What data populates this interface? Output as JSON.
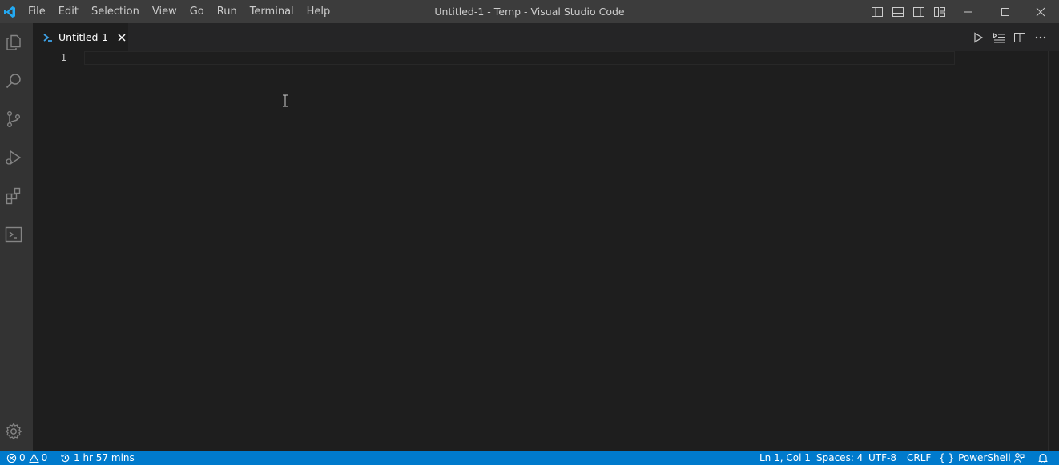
{
  "window": {
    "title": "Untitled-1 - Temp - Visual Studio Code",
    "logo_icon": "vscode-logo-icon",
    "accent_color": "#007acc"
  },
  "menu": {
    "items": [
      "File",
      "Edit",
      "Selection",
      "View",
      "Go",
      "Run",
      "Terminal",
      "Help"
    ]
  },
  "layout_controls": [
    "toggle-primary-sidebar-icon",
    "toggle-panel-icon",
    "toggle-secondary-sidebar-icon",
    "customize-layout-icon"
  ],
  "window_controls": [
    "minimize-icon",
    "maximize-icon",
    "close-icon"
  ],
  "activity_bar": {
    "items": [
      "explorer-icon",
      "search-icon",
      "source-control-icon",
      "run-debug-icon",
      "extensions-icon",
      "remote-explorer-icon"
    ],
    "bottom": "manage-gear-icon"
  },
  "tabs": [
    {
      "label": "Untitled-1",
      "icon": "powershell-icon",
      "active": true
    }
  ],
  "editor_actions": [
    "run-icon",
    "run-selection-icon",
    "split-editor-icon",
    "more-actions-icon"
  ],
  "editor": {
    "line_numbers": [
      "1"
    ]
  },
  "statusbar": {
    "errors": "0",
    "warnings": "0",
    "time_tracker": "1 hr 57 mins",
    "cursor_position": "Ln 1, Col 1",
    "indentation": "Spaces: 4",
    "encoding": "UTF-8",
    "line_endings": "CRLF",
    "language_braces": "{ }",
    "language": "PowerShell"
  }
}
